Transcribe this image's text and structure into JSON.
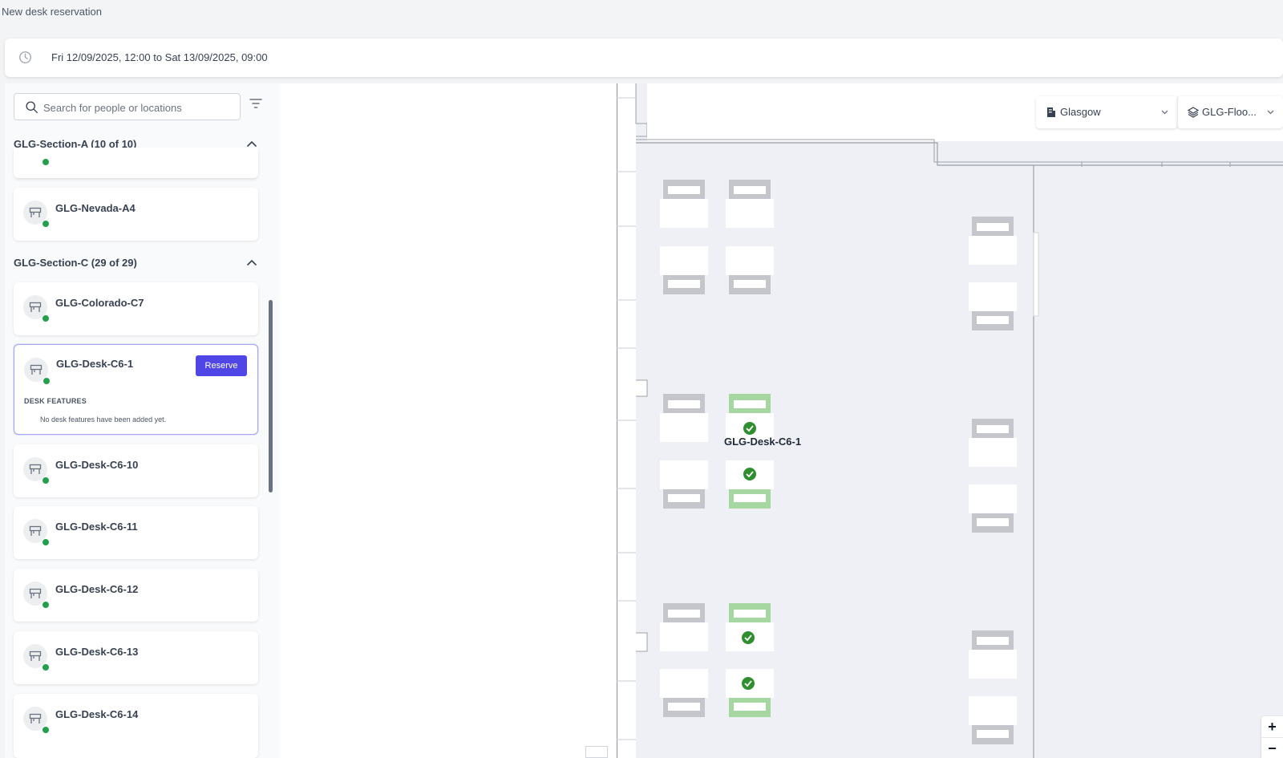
{
  "page": {
    "title": "New desk reservation"
  },
  "date_range": {
    "text": "Fri 12/09/2025, 12:00 to Sat 13/09/2025, 09:00",
    "icon": "clock-icon"
  },
  "search": {
    "placeholder": "Search for people or locations"
  },
  "sections": [
    {
      "label": "GLG-Section-A (10 of 10)"
    },
    {
      "label": "GLG-Section-C (29 of 29)"
    }
  ],
  "desks": [
    {
      "name": "GLG-Nevada-A4",
      "status": "available"
    },
    {
      "name": "GLG-Colorado-C7",
      "status": "available"
    },
    {
      "name": "GLG-Desk-C6-1",
      "status": "available",
      "selected": true,
      "reserve_label": "Reserve",
      "features_title": "DESK FEATURES",
      "features_text": "No desk features have been added yet."
    },
    {
      "name": "GLG-Desk-C6-10",
      "status": "available"
    },
    {
      "name": "GLG-Desk-C6-11",
      "status": "available"
    },
    {
      "name": "GLG-Desk-C6-12",
      "status": "available"
    },
    {
      "name": "GLG-Desk-C6-13",
      "status": "available"
    },
    {
      "name": "GLG-Desk-C6-14",
      "status": "available"
    }
  ],
  "map": {
    "location": "Glasgow",
    "floor": "GLG-Floo...",
    "selected_desk_label": "GLG-Desk-C6-1",
    "zoom_in": "+",
    "zoom_out": "−"
  },
  "colors": {
    "accent": "#4f46e5",
    "available": "#22a04b",
    "desk_available": "#a7d7a0",
    "desk_default": "#c4c6cc",
    "map_bg": "#eef0f5"
  }
}
